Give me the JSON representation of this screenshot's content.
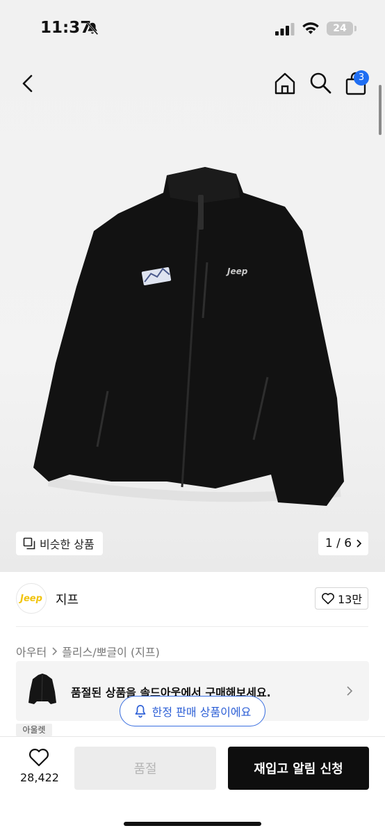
{
  "status_bar": {
    "time": "11:37",
    "battery": "24",
    "icons": [
      "bell-slash-icon",
      "cellular-signal-icon",
      "wifi-icon",
      "battery-icon"
    ]
  },
  "nav": {
    "icons": [
      "back-chevron-icon",
      "home-icon",
      "search-icon",
      "shopping-bag-icon"
    ],
    "cart_count": "3"
  },
  "gallery": {
    "similar_label": "비슷한 상품",
    "page_indicator": "1 / 6",
    "image_icon": "fleece-jacket-photo"
  },
  "brand": {
    "logo_text": "Jeep",
    "name": "지프",
    "like_count": "13만"
  },
  "breadcrumb": {
    "items": [
      "아우터",
      "플리스/뽀글이 (지프)"
    ]
  },
  "soldout_banner": {
    "message": "품절된 상품을 솔드아웃에서 구매해보세요."
  },
  "limited_notice": {
    "label": "한정 판매 상품이에요"
  },
  "outlet_tag": "아울렛",
  "bottom_bar": {
    "wish_count": "28,422",
    "soldout_label": "품절",
    "restock_label": "재입고 알림 신청"
  },
  "colors": {
    "accent_blue": "#2c5fd6",
    "badge_blue": "#1f6ef2",
    "cta_black": "#0e0e0e",
    "jeep_yellow": "#f1c40f"
  }
}
